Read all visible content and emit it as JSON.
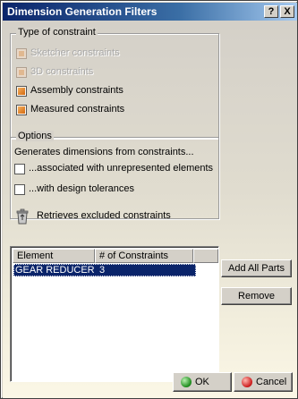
{
  "window": {
    "title": "Dimension Generation Filters",
    "help_glyph": "?",
    "close_glyph": "X"
  },
  "constraint_type": {
    "legend": "Type of constraint",
    "options": [
      {
        "label": "Sketcher constraints",
        "checked": true,
        "enabled": false
      },
      {
        "label": "3D constraints",
        "checked": true,
        "enabled": false
      },
      {
        "label": "Assembly constraints",
        "checked": true,
        "enabled": true
      },
      {
        "label": "Measured constraints",
        "checked": true,
        "enabled": true
      }
    ]
  },
  "options": {
    "legend": "Options",
    "description": "Generates dimensions from constraints...",
    "items": [
      {
        "label": "...associated with unrepresented elements",
        "checked": false
      },
      {
        "label": "...with design tolerances",
        "checked": false
      }
    ]
  },
  "retrieve": {
    "icon": "recycle-icon",
    "label": "Retrieves excluded constraints"
  },
  "table": {
    "columns": [
      "Element",
      "# of Constraints"
    ],
    "rows": [
      {
        "element": "GEAR REDUCER",
        "count": "3",
        "selected": true
      }
    ]
  },
  "buttons": {
    "add_all": "Add All Parts",
    "remove": "Remove",
    "ok": "OK",
    "cancel": "Cancel"
  },
  "colors": {
    "title_bar": "#0a246a",
    "selection": "#0a246a",
    "checkbox_fill": "#d46a10",
    "ok_icon": "#1a8a1a",
    "cancel_icon": "#cc1a1a"
  }
}
